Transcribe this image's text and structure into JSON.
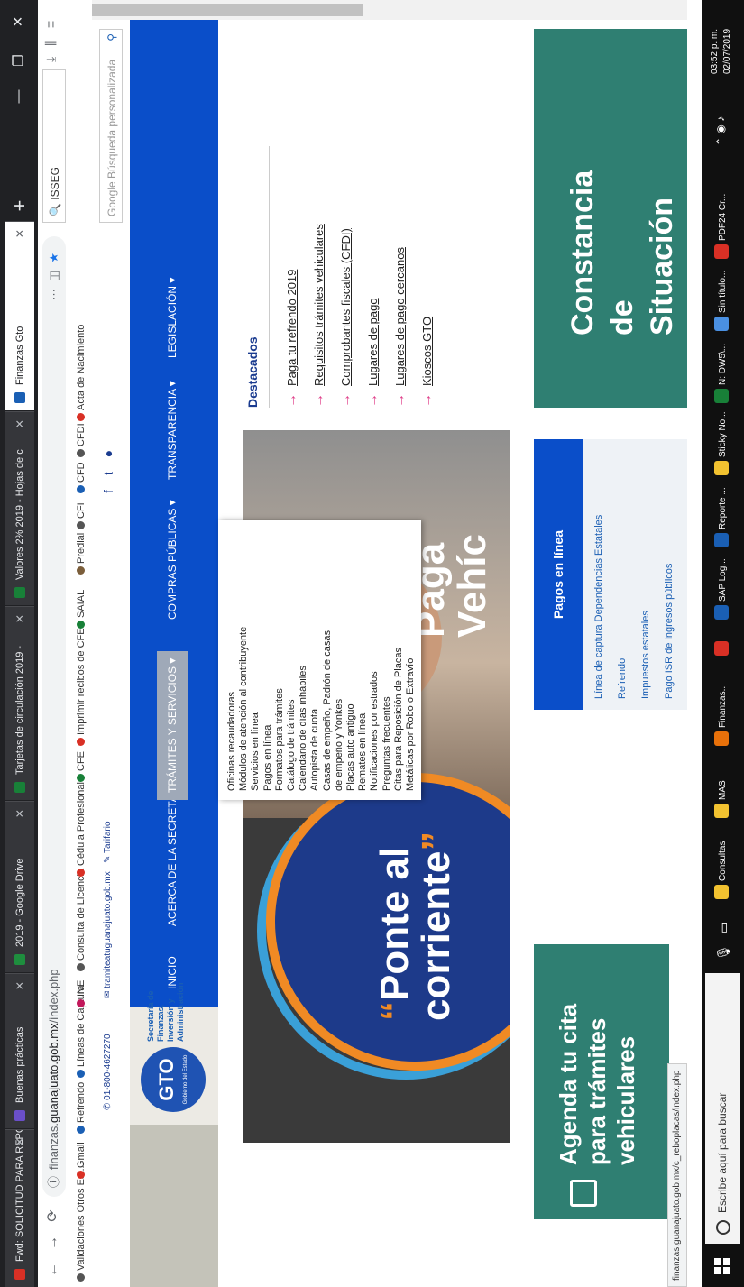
{
  "browser": {
    "tabs": [
      {
        "label": "Fwd: SOLICITUD PARA REPOR",
        "color": "#d93025"
      },
      {
        "label": "Buenas prácticas",
        "color": "#6a4fc9"
      },
      {
        "label": "2019 - Google Drive",
        "color": "#1e8e3e"
      },
      {
        "label": "Tarjetas de circulación 2019 -",
        "color": "#188038"
      },
      {
        "label": "Valores 2% 2019 - Hojas de c",
        "color": "#188038"
      },
      {
        "label": "Finanzas Gto",
        "color": "#1a5fb4"
      }
    ],
    "url_prefix": "finanzas.",
    "url_domain": "guanajuato.gob.mx",
    "url_path": "/index.php",
    "search_value": "ISSEG",
    "bookmarks": [
      {
        "label": "Validaciones Otros Est...",
        "color": "#555555"
      },
      {
        "label": "Gmail",
        "color": "#d93025"
      },
      {
        "label": "Refrendo",
        "color": "#1a5fb4"
      },
      {
        "label": "Líneas de Captura",
        "color": "#1a5fb4"
      },
      {
        "label": "INE",
        "color": "#c2185b"
      },
      {
        "label": "Consulta de Licencia",
        "color": "#555555"
      },
      {
        "label": "Cédula Profesional",
        "color": "#d93025"
      },
      {
        "label": "CFE",
        "color": "#188038"
      },
      {
        "label": "Imprimir recibos de CFE",
        "color": "#d93025"
      },
      {
        "label": "SAIAL",
        "color": "#188038"
      },
      {
        "label": "Predial",
        "color": "#7b5e3b"
      },
      {
        "label": "CFI",
        "color": "#555555"
      },
      {
        "label": "CFD",
        "color": "#1a5fb4"
      },
      {
        "label": "CFDI",
        "color": "#555555"
      },
      {
        "label": "Acta de Nacimiento",
        "color": "#d93025"
      }
    ]
  },
  "site": {
    "phone": "01-800-4627270",
    "email": "tramiteatuguanajuato.gob.mx",
    "extra": "Tarifario",
    "logo_text": "GTO",
    "logo_sub": "Gobierno del Estado",
    "secretaria": "Secretaría de Finanzas, Inversión y Administración",
    "nav": [
      "INICIO",
      "ACERCA DE LA SECRETARÍA",
      "TRÁMITES Y SERVICIOS ▾",
      "COMPRAS PÚBLICAS ▾",
      "TRANSPARENCIA ▾",
      "LEGISLACIÓN ▾"
    ],
    "search_placeholder": "Google Búsqueda personalizada",
    "dropdown": [
      "Oficinas recaudadoras",
      "Módulos de atención al contribuyente",
      "Servicios en línea",
      "Pagos en línea",
      "Formatos para trámites",
      "Catálogo de trámites",
      "Calendario de días inhábiles",
      "Autopista de cuota",
      "Casas de empeño, Padrón de casas",
      "de empeño y Yonkes",
      "Placas auto antiguo",
      "Remates en línea",
      "Notificaciones por estrados",
      "Preguntas frecuentes",
      "Citas para Reposición de Placas",
      "Metálicas por Robo o Extravío"
    ],
    "banner_ponte": "Ponte al",
    "banner_corriente": "corriente",
    "banner_paga": "Paga",
    "banner_vehic": "Vehíc",
    "destacados_title": "Destacados",
    "destacados": [
      "Paga tu refrendo 2019",
      "Requisitos trámites vehiculares",
      "Comprobantes fiscales (CFDI)",
      "Lugares de pago",
      "Lugares de pago cercanos",
      "Kioscos GTO"
    ],
    "agenda": "Agenda tu cita para trámites vehiculares",
    "pagos_title": "Pagos en línea",
    "pagos_links": [
      "Línea de captura Dependencias Estatales",
      "Refrendo",
      "Impuestos estatales",
      "Pago ISR de ingresos públicos"
    ],
    "constancia_1": "Constancia",
    "constancia_2": "de",
    "constancia_3": "Situación"
  },
  "status_url": "finanzas.guanajuato.gob.mx/c_reboplacas/index.php",
  "taskbar": {
    "search_placeholder": "Escribe aquí para buscar",
    "items": [
      {
        "label": "Consultas",
        "color": "#f2c230"
      },
      {
        "label": "MAS",
        "color": "#f2c230"
      },
      {
        "label": "Finanzas...",
        "color": "#e8710a"
      },
      {
        "label": "",
        "color": "#d93025"
      },
      {
        "label": "SAP Log...",
        "color": "#1a5fb4"
      },
      {
        "label": "Reporte ...",
        "color": "#1a5fb4"
      },
      {
        "label": "Sticky No...",
        "color": "#f2c230"
      },
      {
        "label": "N: DW5\\...",
        "color": "#188038"
      },
      {
        "label": "Sin título...",
        "color": "#4a90e2"
      },
      {
        "label": "PDF24 Cr...",
        "color": "#d93025"
      }
    ],
    "time": "03:52 p. m.",
    "date": "02/07/2019"
  }
}
